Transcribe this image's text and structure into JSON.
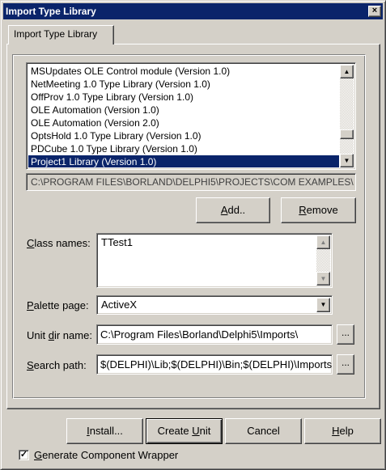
{
  "window": {
    "title": "Import Type Library",
    "close_glyph": "×"
  },
  "tab": {
    "label": "Import Type Library"
  },
  "library_list": {
    "items": [
      "MSUpdates OLE Control module (Version 1.0)",
      "NetMeeting 1.0 Type Library (Version 1.0)",
      "OffProv 1.0 Type Library (Version 1.0)",
      "OLE Automation (Version 1.0)",
      "OLE Automation (Version 2.0)",
      "OptsHold 1.0 Type Library (Version 1.0)",
      "PDCube 1.0 Type Library (Version 1.0)",
      "Project1 Library (Version 1.0)"
    ],
    "selected": 7,
    "scroll_up_glyph": "▲",
    "scroll_down_glyph": "▼"
  },
  "path_display": "C:\\PROGRAM FILES\\BORLAND\\DELPHI5\\PROJECTS\\COM EXAMPLES\\",
  "buttons": {
    "add": {
      "accel": "A",
      "rest": "dd.."
    },
    "remove": {
      "accel": "R",
      "rest": "emove"
    }
  },
  "class_names": {
    "label_accel": "C",
    "label_rest": "lass names:",
    "value": "TTest1",
    "scroll_up_glyph": "▲",
    "scroll_down_glyph": "▼"
  },
  "palette_page": {
    "label_accel": "P",
    "label_rest": "alette page:",
    "value": "ActiveX",
    "drop_glyph": "▼"
  },
  "unit_dir": {
    "label_pre": "Unit ",
    "label_accel": "d",
    "label_rest": "ir name:",
    "value": "C:\\Program Files\\Borland\\Delphi5\\Imports\\",
    "browse_label": "..."
  },
  "search_path": {
    "label_accel": "S",
    "label_rest": "earch path:",
    "value": "$(DELPHI)\\Lib;$(DELPHI)\\Bin;$(DELPHI)\\Imports",
    "browse_label": "..."
  },
  "footer_buttons": {
    "install": {
      "accel": "I",
      "rest": "nstall..."
    },
    "create_unit": {
      "pre": "Create ",
      "accel": "U",
      "rest": "nit"
    },
    "cancel": {
      "label": "Cancel"
    },
    "help": {
      "accel": "H",
      "rest": "elp"
    }
  },
  "generate_wrapper": {
    "checked": true,
    "check_glyph": "✓",
    "label_accel": "G",
    "label_rest": "enerate Component Wrapper"
  },
  "colors": {
    "face": "#d4d0c8",
    "selection": "#0a246a",
    "titlebar": "#0a246a"
  }
}
